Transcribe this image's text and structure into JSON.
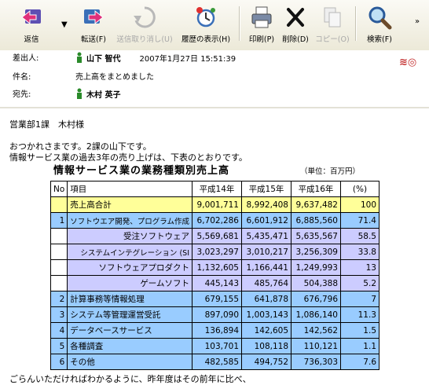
{
  "toolbar": {
    "reply": "返信",
    "forward": "転送(F)",
    "undo_send": "送信取り消し(U)",
    "history": "履歴の表示(H)",
    "print": "印刷(P)",
    "delete": "削除(D)",
    "copy": "コピー(O)",
    "search": "検索(F)"
  },
  "header": {
    "from_label": "差出人:",
    "from_name": "山下 智代",
    "date": "2007年1月27日 15:51:39",
    "subject_label": "件名:",
    "subject": "売上高をまとめました",
    "to_label": "宛先:",
    "to_name": "木村 英子"
  },
  "body": {
    "line1": "営業部1課　木村様",
    "line2": "おつかれさまです。2課の山下です。",
    "line3": "情報サービス業の過去3年の売り上げは、下表のとおりです。",
    "line_last": "ごらんいただければわかるように、昨年度はその前年に比べ、"
  },
  "table": {
    "title": "情報サービス業の業務種類別売上高",
    "unit": "（単位：百万円）",
    "headers": [
      "No",
      "項目",
      "平成14年",
      "平成15年",
      "平成16年",
      "(%)"
    ],
    "total": {
      "no": "",
      "item": "売上高合計",
      "y14": "9,001,711",
      "y15": "8,992,408",
      "y16": "9,637,482",
      "pct": "100"
    },
    "rows": [
      {
        "no": "1",
        "item": "ソフトウエア開発、プログラム作成",
        "y14": "6,702,286",
        "y15": "6,601,912",
        "y16": "6,885,560",
        "pct": "71.4"
      },
      {
        "no": "",
        "item": "受注ソフトウェア",
        "y14": "5,569,681",
        "y15": "5,435,471",
        "y16": "5,635,567",
        "pct": "58.5"
      },
      {
        "no": "",
        "item": "システムインテグレーション (SI",
        "y14": "3,023,297",
        "y15": "3,010,217",
        "y16": "3,256,309",
        "pct": "33.8"
      },
      {
        "no": "",
        "item": "ソフトウェアプロダクト",
        "y14": "1,132,605",
        "y15": "1,166,441",
        "y16": "1,249,993",
        "pct": "13"
      },
      {
        "no": "",
        "item": "ゲームソフト",
        "y14": "445,143",
        "y15": "485,764",
        "y16": "504,388",
        "pct": "5.2"
      },
      {
        "no": "2",
        "item": "計算事務等情報処理",
        "y14": "679,155",
        "y15": "641,878",
        "y16": "676,796",
        "pct": "7"
      },
      {
        "no": "3",
        "item": "システム等管理運営受託",
        "y14": "897,090",
        "y15": "1,003,143",
        "y16": "1,086,140",
        "pct": "11.3"
      },
      {
        "no": "4",
        "item": "データベースサービス",
        "y14": "136,894",
        "y15": "142,605",
        "y16": "142,562",
        "pct": "1.5"
      },
      {
        "no": "5",
        "item": "各種調査",
        "y14": "103,701",
        "y15": "108,118",
        "y16": "110,121",
        "pct": "1.1"
      },
      {
        "no": "6",
        "item": "その他",
        "y14": "482,585",
        "y15": "494,752",
        "y16": "736,303",
        "pct": "7.6"
      }
    ]
  },
  "colors": {
    "total_row": "#ffff99",
    "main_row": "#99ccff",
    "sub_row": "#ccccff"
  }
}
